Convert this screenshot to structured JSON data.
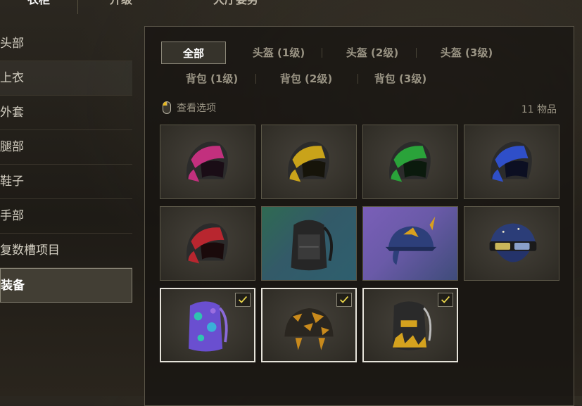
{
  "top_tabs": [
    {
      "label": "衣柜",
      "active": true
    },
    {
      "label": "升级",
      "active": false
    },
    {
      "label": "大厅姿势",
      "active": false
    }
  ],
  "sidebar": {
    "items": [
      {
        "label": "头部"
      },
      {
        "label": "上衣"
      },
      {
        "label": "外套"
      },
      {
        "label": "腿部"
      },
      {
        "label": "鞋子"
      },
      {
        "label": "手部"
      },
      {
        "label": "复数槽项目"
      },
      {
        "label": "装备",
        "active": true
      }
    ]
  },
  "filters": {
    "row1": [
      "全部",
      "头盔 (1级)",
      "头盔 (2级)",
      "头盔 (3级)"
    ],
    "row2": [
      "背包 (1级)",
      "背包 (2级)",
      "背包 (3级)"
    ],
    "active": "全部"
  },
  "view_options": {
    "label": "查看选项",
    "icon": "mouse-icon"
  },
  "item_count": "11 物品",
  "items": [
    {
      "name": "helmet-pink",
      "color": "#c2307e",
      "selected": false
    },
    {
      "name": "helmet-yellow",
      "color": "#c9a31a",
      "selected": false
    },
    {
      "name": "helmet-green",
      "color": "#2aa33a",
      "selected": false
    },
    {
      "name": "helmet-blue",
      "color": "#2f4fc9",
      "selected": false
    },
    {
      "name": "helmet-red",
      "color": "#b8262f",
      "selected": false
    },
    {
      "name": "backpack-black",
      "color": "#2a2a2a",
      "selected": false
    },
    {
      "name": "helmet-navy-gold",
      "color": "#2d3f7a",
      "selected": false
    },
    {
      "name": "helmet-starry",
      "color": "#2b3d78",
      "selected": false
    },
    {
      "name": "backpack-galaxy",
      "color": "#6a4fd0",
      "selected": true
    },
    {
      "name": "helmet-camo",
      "color": "#c98a1c",
      "selected": true
    },
    {
      "name": "backpack-gold-black",
      "color": "#d4a21e",
      "selected": true
    }
  ]
}
